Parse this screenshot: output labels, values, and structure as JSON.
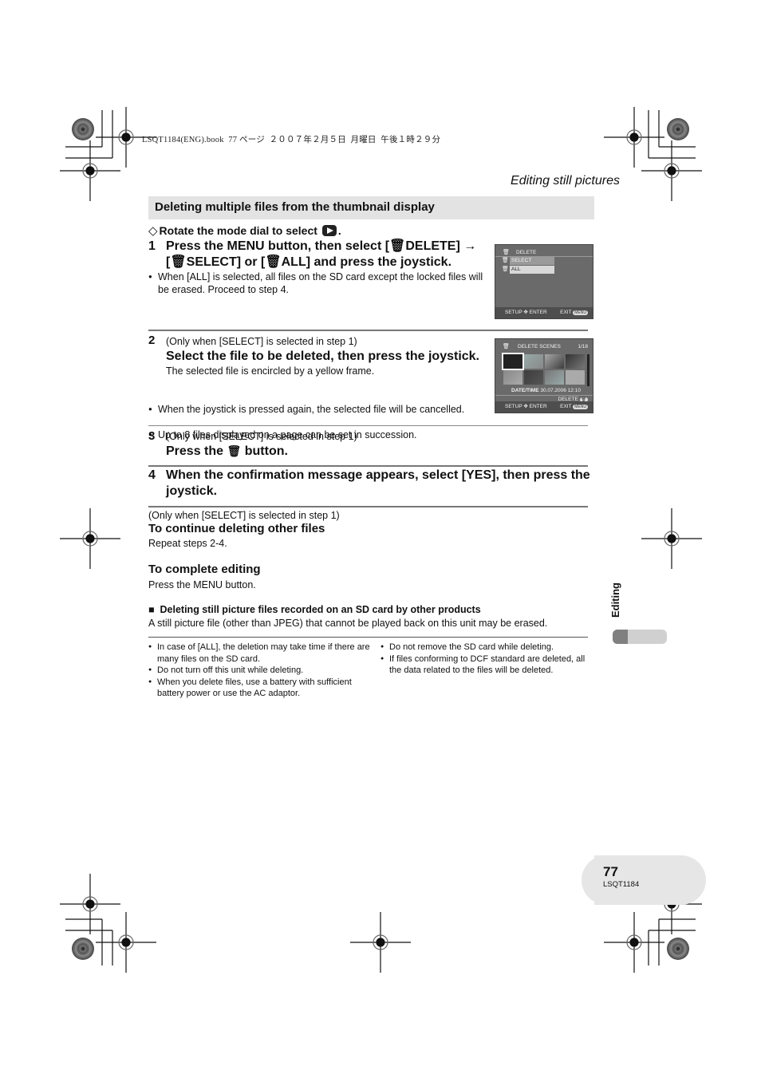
{
  "print_header": {
    "book_info": "LSQT1184(ENG).book  77 ページ  ２００７年２月５日  月曜日  午後１時２９分"
  },
  "running_head": "Editing still pictures",
  "section": {
    "title": "Deleting multiple files from the thumbnail display",
    "prestep_marker": "◇",
    "prestep_text": "Rotate the mode dial to select",
    "prestep_icon": "playback-mode-icon",
    "prestep_end": "."
  },
  "steps": [
    {
      "number": "1",
      "heading_line1": "Press the MENU button, then select [",
      "heading_delete": "DELETE] →",
      "heading_line2a": "[",
      "heading_select": "SELECT] or [",
      "heading_all": "ALL] and press the joystick.",
      "bullets": [
        "When [ALL] is selected, all files on the SD card except the locked files will be erased. Proceed to step 4."
      ]
    },
    {
      "number": "2",
      "condition": "(Only when [SELECT] is selected in step 1)",
      "heading": "Select the file to be deleted, then press the joystick.",
      "note": "The selected file is encircled by a yellow frame.",
      "bullets": [
        "When the joystick is pressed again, the selected file will be cancelled.",
        "Up to 8 files displayed on a page can be set in succession."
      ]
    },
    {
      "number": "3",
      "condition": "(Only when [SELECT] is selected in step 1)",
      "heading_pre": "Press the",
      "heading_post": "button."
    },
    {
      "number": "4",
      "heading": "When the confirmation message appears, select [YES], then press the joystick."
    }
  ],
  "continue": {
    "condition": "(Only when [SELECT] is selected in step 1)",
    "heading": "To continue deleting other files",
    "text": "Repeat steps 2-4."
  },
  "complete": {
    "heading": "To complete editing",
    "text": "Press the MENU button."
  },
  "other_products": {
    "marker": "■",
    "heading": "Deleting still picture files recorded on an SD card by other products",
    "text": "A still picture file (other than JPEG) that cannot be played back on this unit may be erased."
  },
  "notes_left": [
    "In case of [ALL], the deletion may take time if there are many files on the SD card.",
    "Do not turn off this unit while deleting.",
    "When you delete files, use a battery with sufficient battery power or use the AC adaptor."
  ],
  "notes_right": [
    "Do not remove the SD card while deleting.",
    "If files conforming to DCF standard are deleted, all the data related to the files will be deleted."
  ],
  "screen1": {
    "title": "DELETE",
    "options": [
      "SELECT",
      "ALL"
    ],
    "footer_left": "SETUP ✥ ENTER",
    "footer_right": "EXIT",
    "menu_pill": "MENU"
  },
  "screen2": {
    "title": "DELETE SCENES",
    "page": "1/18",
    "date_label": "DATE/TIME",
    "date_value": "30.07.2006  12:10",
    "delete_label": "DELETE",
    "footer_left": "SETUP ✥ ENTER",
    "footer_right": "EXIT",
    "menu_pill": "MENU"
  },
  "side_tab": {
    "label": "Editing",
    "progress_fraction": 0.28,
    "color_fill": "#808080",
    "color_track": "#d0d0d0"
  },
  "footer": {
    "page_number": "77",
    "doc_code": "LSQT1184"
  }
}
